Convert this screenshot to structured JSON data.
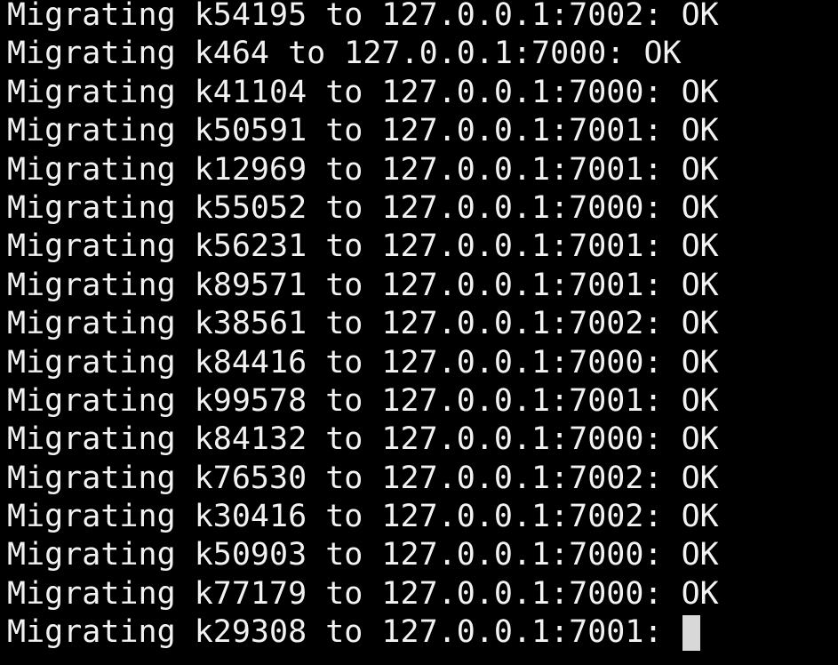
{
  "terminal": {
    "lines": [
      {
        "text": "Migrating k54195 to 127.0.0.1:7002: OK"
      },
      {
        "text": "Migrating k464 to 127.0.0.1:7000: OK"
      },
      {
        "text": "Migrating k41104 to 127.0.0.1:7000: OK"
      },
      {
        "text": "Migrating k50591 to 127.0.0.1:7001: OK"
      },
      {
        "text": "Migrating k12969 to 127.0.0.1:7001: OK"
      },
      {
        "text": "Migrating k55052 to 127.0.0.1:7000: OK"
      },
      {
        "text": "Migrating k56231 to 127.0.0.1:7001: OK"
      },
      {
        "text": "Migrating k89571 to 127.0.0.1:7001: OK"
      },
      {
        "text": "Migrating k38561 to 127.0.0.1:7002: OK"
      },
      {
        "text": "Migrating k84416 to 127.0.0.1:7000: OK"
      },
      {
        "text": "Migrating k99578 to 127.0.0.1:7001: OK"
      },
      {
        "text": "Migrating k84132 to 127.0.0.1:7000: OK"
      },
      {
        "text": "Migrating k76530 to 127.0.0.1:7002: OK"
      },
      {
        "text": "Migrating k30416 to 127.0.0.1:7002: OK"
      },
      {
        "text": "Migrating k50903 to 127.0.0.1:7000: OK"
      },
      {
        "text": "Migrating k77179 to 127.0.0.1:7000: OK"
      },
      {
        "text": "Migrating k29308 to 127.0.0.1:7001:"
      }
    ],
    "colors": {
      "background": "#000000",
      "foreground": "#f2f2f2",
      "cursor": "#d8d8d8"
    }
  }
}
